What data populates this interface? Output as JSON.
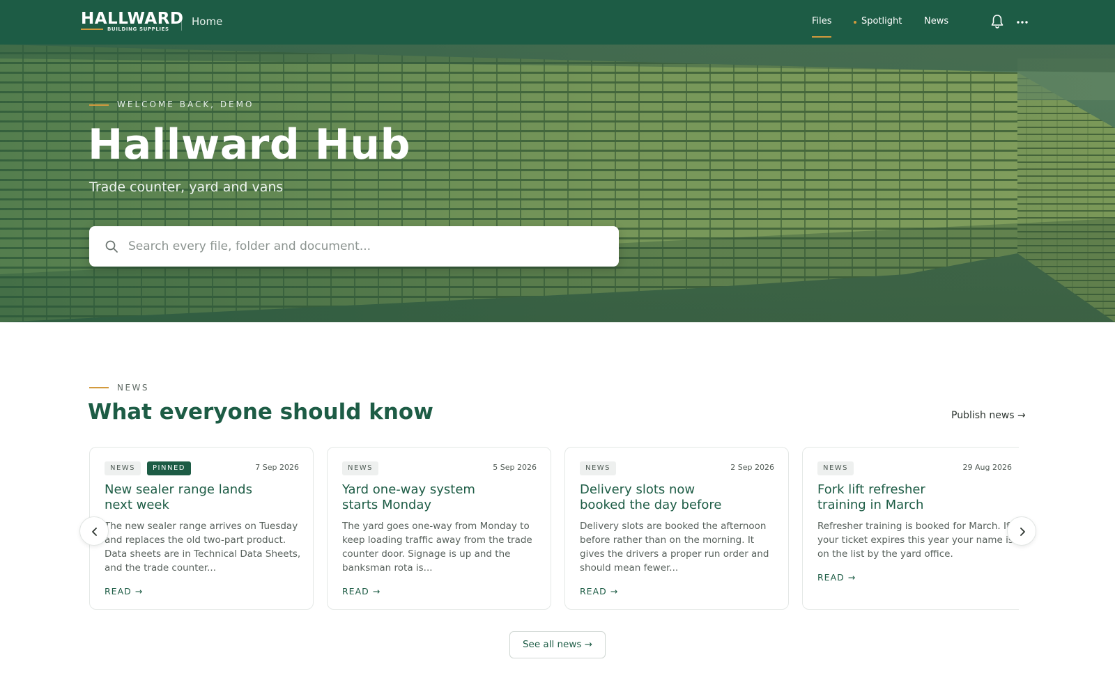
{
  "header": {
    "brand_name": "HALLWARD",
    "brand_sub": "BUILDING SUPPLIES",
    "home_label": "Home",
    "nav": [
      {
        "label": "Files",
        "active": true
      },
      {
        "label": "Spotlight",
        "active": false
      },
      {
        "label": "News",
        "active": false
      }
    ],
    "icons": [
      "bell-icon",
      "more-icon"
    ]
  },
  "hero": {
    "eyebrow": "WELCOME BACK, DEMO",
    "title": "Hallward Hub",
    "subtitle": "Trade counter, yard and vans",
    "search_placeholder": "Search every file, folder and document..."
  },
  "news": {
    "eyebrow": "NEWS",
    "heading": "What everyone should know",
    "publish_label": "Publish news →",
    "see_all_label": "See all news →",
    "cards": [
      {
        "tag": "NEWS",
        "pinned": "PINNED",
        "date": "7 Sep 2026",
        "title": "New sealer range lands next week",
        "body": "The new sealer range arrives on Tuesday and replaces the old two-part product. Data sheets are in Technical Data Sheets, and the trade counter...",
        "read": "READ →"
      },
      {
        "tag": "NEWS",
        "date": "5 Sep 2026",
        "title": "Yard one-way system starts Monday",
        "body": "The yard goes one-way from Monday to keep loading traffic away from the trade counter door. Signage is up and the banksman rota is...",
        "read": "READ →"
      },
      {
        "tag": "NEWS",
        "date": "2 Sep 2026",
        "title": "Delivery slots now booked the day before",
        "body": "Delivery slots are booked the afternoon before rather than on the morning. It gives the drivers a proper run order and should mean fewer...",
        "read": "READ →"
      },
      {
        "tag": "NEWS",
        "date": "29 Aug 2026",
        "title": "Fork lift refresher training in March",
        "body": "Refresher training is booked for March. If your ticket expires this year your name is on the list by the yard office.",
        "read": "READ →"
      }
    ]
  },
  "colors": {
    "brand_green": "#1d5c45",
    "accent_gold": "#d39a3d"
  }
}
